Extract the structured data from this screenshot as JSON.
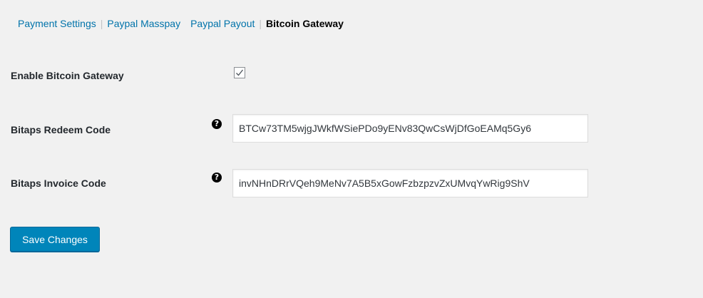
{
  "subnav": {
    "items": [
      {
        "label": "Payment Settings"
      },
      {
        "label": "Paypal Masspay"
      },
      {
        "label": "Paypal Payout"
      },
      {
        "label": "Bitcoin Gateway"
      }
    ]
  },
  "settings": {
    "enable_label": "Enable Bitcoin Gateway",
    "enable_checked": true,
    "redeem_label": "Bitaps Redeem Code",
    "redeem_value": "BTCw73TM5wjgJWkfWSiePDo9yENv83QwCsWjDfGoEAMq5Gy6",
    "invoice_label": "Bitaps Invoice Code",
    "invoice_value": "invNHnDRrVQeh9MeNv7A5B5xGowFzbzpzvZxUMvqYwRig9ShV",
    "help_icon": "question-circle-icon"
  },
  "actions": {
    "save_label": "Save Changes"
  },
  "colors": {
    "background": "#f1f1f1",
    "link": "#0073aa",
    "primary_button": "#0085ba"
  }
}
